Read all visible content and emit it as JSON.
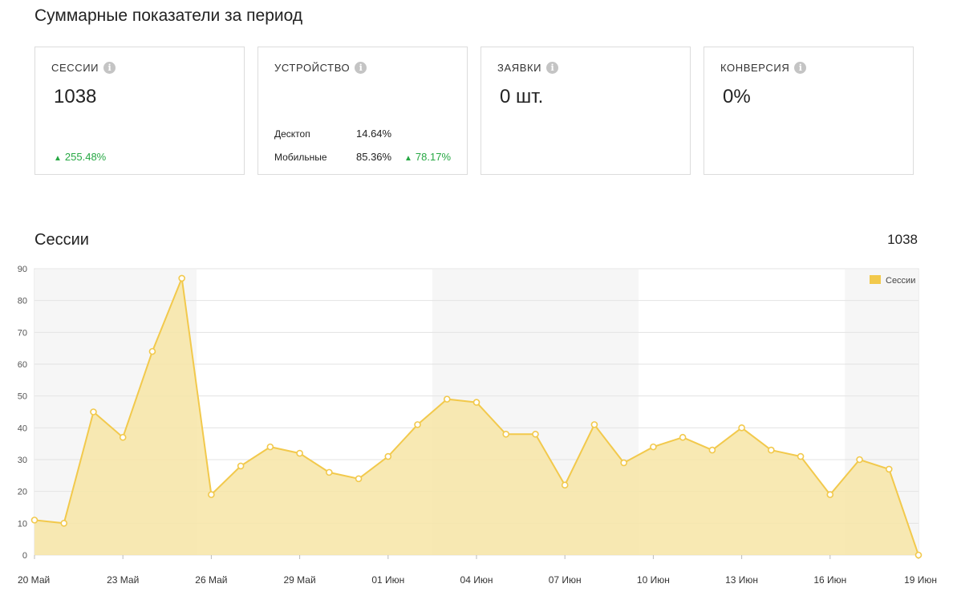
{
  "page_title": "Суммарные показатели за период",
  "cards": {
    "sessions": {
      "label": "СЕССИИ",
      "value": "1038",
      "delta": "255.48%"
    },
    "device": {
      "label": "УСТРОЙСТВО",
      "rows": [
        {
          "name": "Десктоп",
          "pct": "14.64%",
          "delta": ""
        },
        {
          "name": "Мобильные",
          "pct": "85.36%",
          "delta": "78.17%"
        }
      ]
    },
    "orders": {
      "label": "ЗАЯВКИ",
      "value": "0 шт."
    },
    "conversion": {
      "label": "КОНВЕРСИЯ",
      "value": "0%"
    }
  },
  "info_icon": {
    "name": "info-icon",
    "glyph": "i"
  },
  "delta_icon": {
    "name": "triangle-up-icon",
    "glyph": "▲"
  },
  "chart_section": {
    "title": "Сессии",
    "total": "1038"
  },
  "colors": {
    "line": "#f2c94c",
    "fill": "#f7e5a6",
    "delta_positive": "#27a844",
    "weekend_band": "#f6f6f6",
    "grid": "#e3e3e3"
  },
  "chart_data": {
    "type": "area",
    "x": [
      "2024-05-20",
      "2024-05-21",
      "2024-05-22",
      "2024-05-23",
      "2024-05-24",
      "2024-05-25",
      "2024-05-26",
      "2024-05-27",
      "2024-05-28",
      "2024-05-29",
      "2024-05-30",
      "2024-05-31",
      "2024-06-01",
      "2024-06-02",
      "2024-06-03",
      "2024-06-04",
      "2024-06-05",
      "2024-06-06",
      "2024-06-07",
      "2024-06-08",
      "2024-06-09",
      "2024-06-10",
      "2024-06-11",
      "2024-06-12",
      "2024-06-13",
      "2024-06-14",
      "2024-06-15",
      "2024-06-16",
      "2024-06-17",
      "2024-06-18",
      "2024-06-19"
    ],
    "series": [
      {
        "name": "Сессии",
        "values": [
          11,
          10,
          45,
          37,
          64,
          87,
          19,
          28,
          34,
          32,
          26,
          24,
          31,
          41,
          49,
          48,
          38,
          38,
          22,
          41,
          29,
          34,
          37,
          33,
          40,
          33,
          31,
          19,
          30,
          27,
          0
        ]
      }
    ],
    "x_tick_labels": [
      "20 Май",
      "23 Май",
      "26 Май",
      "29 Май",
      "01 Июн",
      "04 Июн",
      "07 Июн",
      "10 Июн",
      "13 Июн",
      "16 Июн",
      "19 Июн"
    ],
    "x_tick_every": 3,
    "y_ticks": [
      0,
      10,
      20,
      30,
      40,
      50,
      60,
      70,
      80,
      90
    ],
    "ylim": [
      0,
      90
    ],
    "shaded_ranges": [
      [
        "2024-05-20",
        "2024-05-25"
      ],
      [
        "2024-06-03",
        "2024-06-09"
      ],
      [
        "2024-06-17",
        "2024-06-19"
      ]
    ],
    "legend": {
      "label": "Сессии",
      "position": "top-right"
    },
    "grid": true
  }
}
